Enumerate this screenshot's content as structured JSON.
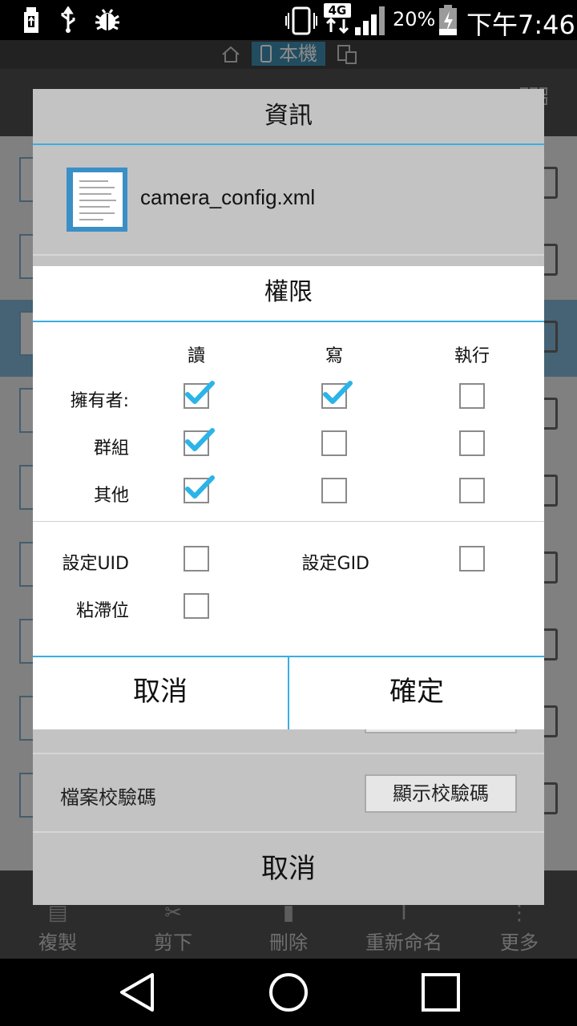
{
  "status_bar": {
    "network_type": "4G",
    "battery_percent": "20%",
    "clock": "下午7:46",
    "icons": [
      "usb-icon",
      "usb-debug-icon",
      "bug-icon",
      "vibrate-icon",
      "network-4g-icon",
      "signal-icon",
      "battery-charging-icon"
    ]
  },
  "app": {
    "location_tab": "本機",
    "bottom_bar": [
      {
        "label": "複製",
        "icon": "copy-icon"
      },
      {
        "label": "剪下",
        "icon": "cut-icon"
      },
      {
        "label": "刪除",
        "icon": "delete-icon"
      },
      {
        "label": "重新命名",
        "icon": "rename-icon"
      },
      {
        "label": "更多",
        "icon": "more-icon"
      }
    ]
  },
  "info_dialog": {
    "title": "資訊",
    "file_name": "camera_config.xml",
    "checksum_label": "檔案校驗碼",
    "checksum_button": "顯示校驗碼",
    "cancel": "取消"
  },
  "permission_dialog": {
    "title": "權限",
    "columns": [
      "讀",
      "寫",
      "執行"
    ],
    "rows": [
      {
        "label": "擁有者:",
        "checked": [
          true,
          true,
          false
        ]
      },
      {
        "label": "群組",
        "checked": [
          true,
          false,
          false
        ]
      },
      {
        "label": "其他",
        "checked": [
          true,
          false,
          false
        ]
      }
    ],
    "special": {
      "set_uid_label": "設定UID",
      "set_uid_checked": false,
      "set_gid_label": "設定GID",
      "set_gid_checked": false,
      "sticky_label": "粘滯位",
      "sticky_checked": false
    },
    "cancel": "取消",
    "ok": "確定"
  },
  "colors": {
    "accent": "#3aaee0",
    "check": "#2bb4e8",
    "highlight_row": "#7eb5d3"
  }
}
